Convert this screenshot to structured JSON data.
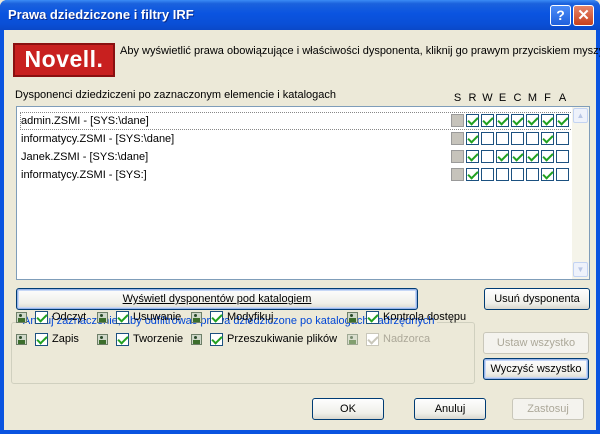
{
  "window": {
    "title": "Prawa dziedziczone i filtry IRF",
    "help_button": "?",
    "close_button": "✕"
  },
  "logo": {
    "text": "Novell."
  },
  "info_text": "Aby wyświetlić prawa obowiązujące i właściwości dysponenta, kliknij go prawym przyciskiem myszy.",
  "list": {
    "label": "Dysponenci dziedziczeni po zaznaczonym elemencie i katalogach",
    "columns": [
      "S",
      "R",
      "W",
      "E",
      "C",
      "M",
      "F",
      "A"
    ],
    "rows": [
      {
        "name": "admin.ZSMI - [SYS:\\dane]",
        "rights": [
          false,
          true,
          true,
          true,
          true,
          true,
          true,
          true
        ]
      },
      {
        "name": "informatycy.ZSMI - [SYS:\\dane]",
        "rights": [
          false,
          true,
          false,
          false,
          false,
          false,
          true,
          false
        ]
      },
      {
        "name": "Janek.ZSMI - [SYS:\\dane]",
        "rights": [
          false,
          true,
          false,
          true,
          true,
          true,
          true,
          false
        ]
      },
      {
        "name": "informatycy.ZSMI - [SYS:]",
        "rights": [
          false,
          true,
          false,
          false,
          false,
          false,
          true,
          false
        ]
      }
    ]
  },
  "buttons": {
    "show_trustees": "Wyświetl dysponentów pod katalogiem",
    "remove_trustee": "Usuń dysponenta",
    "set_all": "Ustaw wszystko",
    "clear_all": "Wyczyść wszystko",
    "ok": "OK",
    "cancel": "Anuluj",
    "apply": "Zastosuj"
  },
  "filter_group": {
    "title": "Anuluj zaznaczenie, aby odfiltrować prawa dziedziczone po katalogach nadrzędnych",
    "items": [
      {
        "label": "Odczyt",
        "checked": true,
        "enabled": true
      },
      {
        "label": "Usuwanie",
        "checked": true,
        "enabled": true
      },
      {
        "label": "Modyfikuj",
        "checked": true,
        "enabled": true
      },
      {
        "label": "Kontrola dostępu",
        "checked": true,
        "enabled": true
      },
      {
        "label": "Zapis",
        "checked": true,
        "enabled": true
      },
      {
        "label": "Tworzenie",
        "checked": true,
        "enabled": true
      },
      {
        "label": "Przeszukiwanie plików",
        "checked": true,
        "enabled": true
      },
      {
        "label": "Nadzorca",
        "checked": true,
        "enabled": false
      }
    ]
  }
}
